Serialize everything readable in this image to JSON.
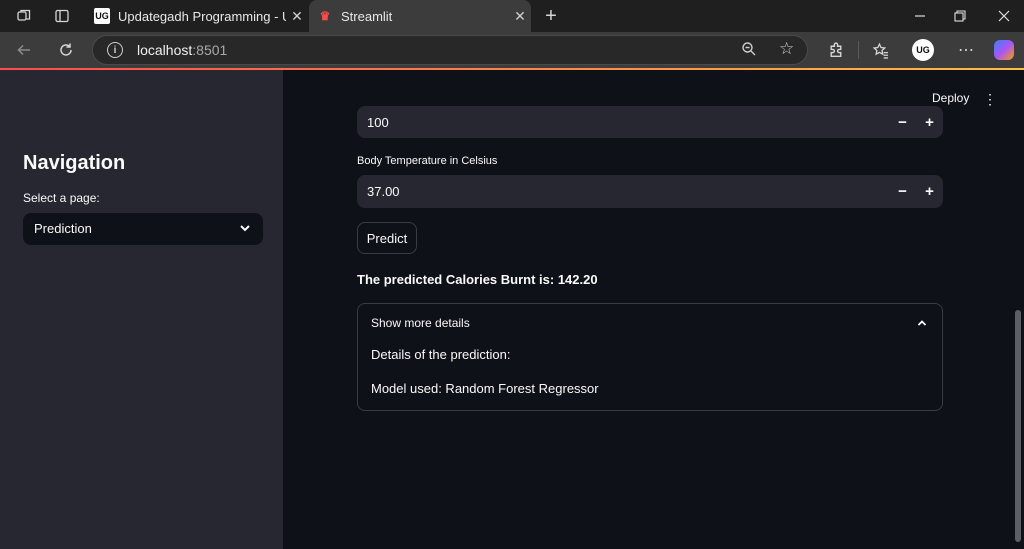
{
  "browser": {
    "tabs": [
      {
        "title": "Updategadh Programming - Upd",
        "favicon": "UG",
        "active": false
      },
      {
        "title": "Streamlit",
        "favicon": "streamlit-crown",
        "active": true
      }
    ],
    "address": {
      "host": "localhost",
      "port": ":8501"
    },
    "profile_initials": "UG"
  },
  "sidebar": {
    "title": "Navigation",
    "select_label": "Select a page:",
    "select_value": "Prediction"
  },
  "header": {
    "deploy_label": "Deploy"
  },
  "main": {
    "partial_input_value": "100",
    "temperature_label": "Body Temperature in Celsius",
    "temperature_value": "37.00",
    "predict_label": "Predict",
    "result_text": "The predicted Calories Burnt is: 142.20",
    "expander": {
      "label": "Show more details",
      "expanded": true,
      "line1": "Details of the prediction:",
      "line2": "Model used: Random Forest Regressor"
    }
  },
  "colors": {
    "app_background": "#0e1117",
    "sidebar_background": "#262730",
    "accent_gradient_start": "#ff4b4b",
    "accent_gradient_end": "#ffbd45"
  }
}
